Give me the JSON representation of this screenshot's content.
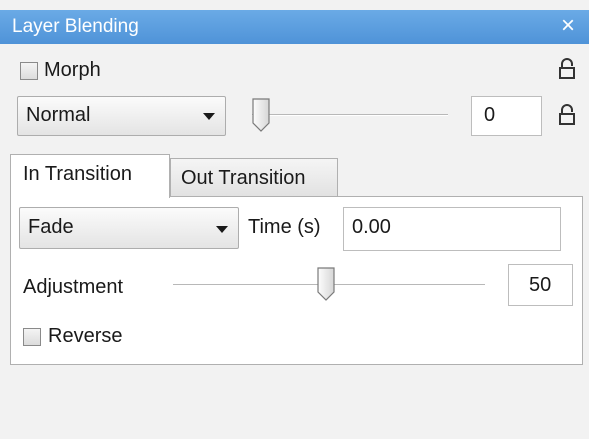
{
  "window": {
    "title": "Layer Blending",
    "close_icon": "×"
  },
  "morph": {
    "label": "Morph",
    "checked": false
  },
  "blend": {
    "mode": "Normal",
    "opacity_value": "0",
    "opacity_level": 0
  },
  "tabs": [
    {
      "label": "In Transition",
      "active": true
    },
    {
      "label": "Out Transition",
      "active": false
    }
  ],
  "transition": {
    "type": "Fade",
    "time_label": "Time (s)",
    "time_value": "0.00",
    "adjustment_label": "Adjustment",
    "adjustment_value": "50",
    "adjustment_level": 50,
    "reverse_label": "Reverse",
    "reverse_checked": false
  },
  "colors": {
    "title_bar": "#5a9ee0",
    "panel_bg": "#f2f2f2"
  },
  "icons": {
    "morph_lock": "lock-icon",
    "blend_lock": "lock-icon",
    "close": "close-icon",
    "dropdown": "chevron-down-icon"
  }
}
